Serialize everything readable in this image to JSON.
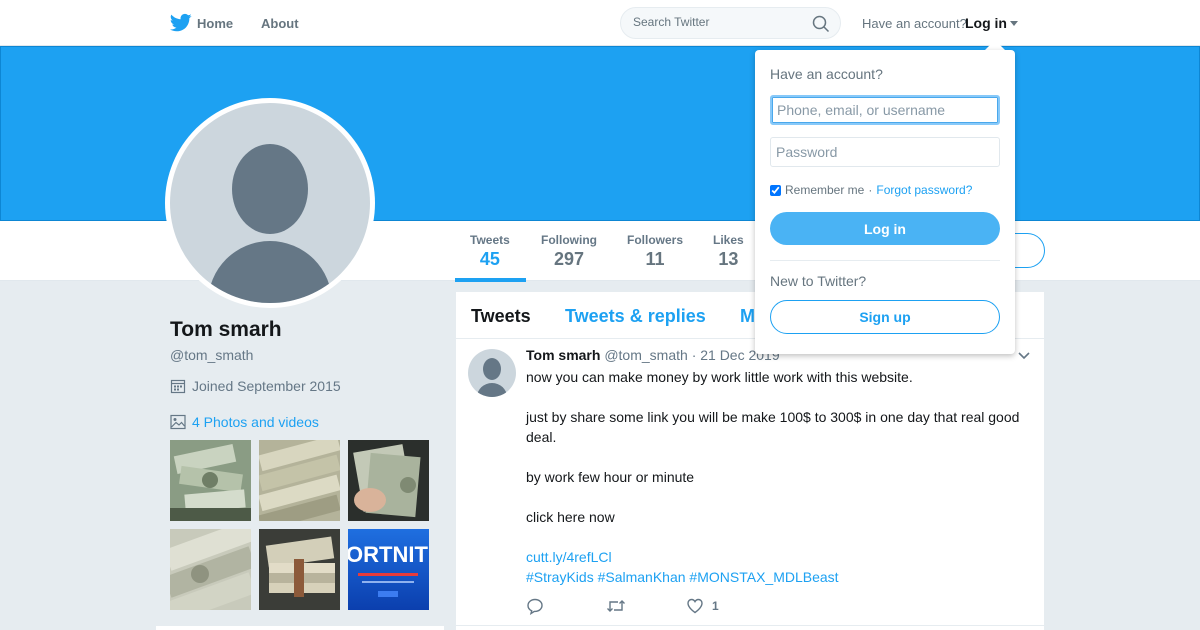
{
  "nav": {
    "logo_icon": "twitter-bird-icon",
    "home_label": "Home",
    "about_label": "About",
    "search_placeholder": "Search Twitter",
    "have_account": "Have an account?",
    "login_label": "Log in"
  },
  "colors": {
    "brand": "#1da1f2",
    "banner": "#1da1f2",
    "text": "#14171a",
    "muted": "#657786",
    "login_button": "#4ab3f4"
  },
  "profile": {
    "name": "Tom smarh",
    "handle": "@tom_smath",
    "joined": "Joined September 2015",
    "photos_link": "4 Photos and videos"
  },
  "stats": [
    {
      "label": "Tweets",
      "value": "45"
    },
    {
      "label": "Following",
      "value": "297"
    },
    {
      "label": "Followers",
      "value": "11"
    },
    {
      "label": "Likes",
      "value": "13"
    }
  ],
  "timeline": {
    "tabs": [
      "Tweets",
      "Tweets & replies",
      "M"
    ]
  },
  "tweet": {
    "name": "Tom smarh",
    "handle": "@tom_smath",
    "date": "· 21 Dec 2019",
    "lines": [
      "now you can make money by work little work with this website.",
      "",
      "just by share some link you will be make 100$ to 300$ in one day that real good deal.",
      "",
      "by work few hour or minute",
      "",
      "click here now",
      ""
    ],
    "link": "cutt.ly/4refLCl",
    "hashtags": "#StrayKids #SalmanKhan #MONSTAX_MDLBeast",
    "like_count": "1"
  },
  "login_dropdown": {
    "title": "Have an account?",
    "username_placeholder": "Phone, email, or username",
    "password_placeholder": "Password",
    "remember_label": "Remember me",
    "separator": "·",
    "forgot_label": "Forgot password?",
    "login_button": "Log in",
    "new_label": "New to Twitter?",
    "signup_button": "Sign up"
  },
  "thumbnails_overlay": {
    "last_thumb_text": "ORTNITE"
  }
}
